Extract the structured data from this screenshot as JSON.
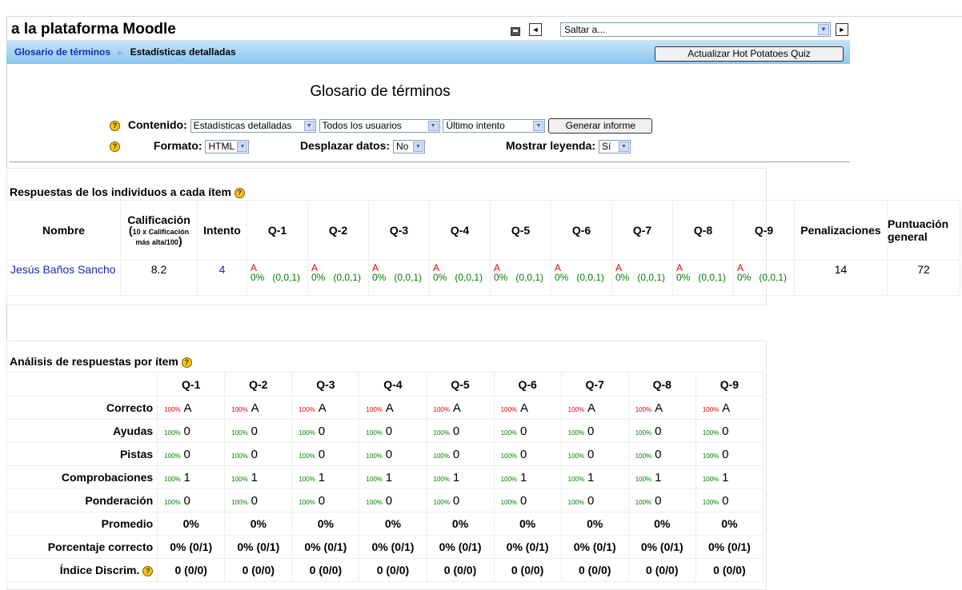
{
  "header": {
    "site_title": "a la plataforma Moodle",
    "jump_placeholder": "Saltar a...",
    "prev_arrow": "◄",
    "next_arrow": "►"
  },
  "breadcrumb": {
    "item1": "Glosario de términos",
    "item2": "Estadísticas detalladas",
    "separator": "►"
  },
  "update_button": "Actualizar Hot Potatoes Quiz",
  "page_title": "Glosario de términos",
  "form": {
    "contenido_label": "Contenido:",
    "contenido_value": "Estadísticas detalladas",
    "usuarios_value": "Todos los usuarios",
    "intento_value": "Último intento",
    "generate_button": "Generar informe",
    "formato_label": "Formato:",
    "formato_value": "HTML",
    "desplazar_label": "Desplazar datos:",
    "desplazar_value": "No",
    "leyenda_label": "Mostrar leyenda:",
    "leyenda_value": "Sí"
  },
  "responses_table": {
    "title": "Respuestas de los individuos a cada ítem",
    "col_nombre": "Nombre",
    "col_calificacion": "Calificación",
    "col_calif_sub1": "(",
    "col_calif_sub_small": "10 x Calificación más alta/100",
    "col_calif_sub2": ")",
    "col_intento": "Intento",
    "questions": [
      "Q-1",
      "Q-2",
      "Q-3",
      "Q-4",
      "Q-5",
      "Q-6",
      "Q-7",
      "Q-8",
      "Q-9"
    ],
    "col_penalizaciones": "Penalizaciones",
    "col_puntuacion": "Puntuación general",
    "row": {
      "name": "Jesús Baños Sancho",
      "grade": "8.2",
      "attempt": "4",
      "cells": [
        {
          "a": "A",
          "pct": "0%",
          "code": "(0,0,1)"
        },
        {
          "a": "A",
          "pct": "0%",
          "code": "(0,0,1)"
        },
        {
          "a": "A",
          "pct": "0%",
          "code": "(0,0,1)"
        },
        {
          "a": "A",
          "pct": "0%",
          "code": "(0,0,1)"
        },
        {
          "a": "A",
          "pct": "0%",
          "code": "(0,0,1)"
        },
        {
          "a": "A",
          "pct": "0%",
          "code": "(0,0,1)"
        },
        {
          "a": "A",
          "pct": "0%",
          "code": "(0,0,1)"
        },
        {
          "a": "A",
          "pct": "0%",
          "code": "(0,0,1)"
        },
        {
          "a": "A",
          "pct": "0%",
          "code": "(0,0,1)"
        }
      ],
      "penalties": "14",
      "overall": "72"
    }
  },
  "analysis_table": {
    "title": "Análisis de respuestas por ítem",
    "questions": [
      "Q-1",
      "Q-2",
      "Q-3",
      "Q-4",
      "Q-5",
      "Q-6",
      "Q-7",
      "Q-8",
      "Q-9"
    ],
    "rows": [
      {
        "label": "Correcto",
        "pct": "100%",
        "value": "A",
        "kind": "red"
      },
      {
        "label": "Ayudas",
        "pct": "100%",
        "value": "0",
        "kind": "green"
      },
      {
        "label": "Pistas",
        "pct": "100%",
        "value": "0",
        "kind": "green"
      },
      {
        "label": "Comprobaciones",
        "pct": "100%",
        "value": "1",
        "kind": "green"
      },
      {
        "label": "Ponderación",
        "pct": "100%",
        "value": "0",
        "kind": "green"
      }
    ],
    "summary_rows": [
      {
        "label": "Promedio",
        "values": [
          "0%",
          "0%",
          "0%",
          "0%",
          "0%",
          "0%",
          "0%",
          "0%",
          "0%"
        ]
      },
      {
        "label": "Porcentaje correcto",
        "values": [
          "0% (0/1)",
          "0% (0/1)",
          "0% (0/1)",
          "0% (0/1)",
          "0% (0/1)",
          "0% (0/1)",
          "0% (0/1)",
          "0% (0/1)",
          "0% (0/1)"
        ]
      },
      {
        "label": "Índice Discrim.",
        "values": [
          "0 (0/0)",
          "0 (0/0)",
          "0 (0/0)",
          "0 (0/0)",
          "0 (0/0)",
          "0 (0/0)",
          "0 (0/0)",
          "0 (0/0)",
          "0 (0/0)"
        ],
        "help": true
      }
    ]
  },
  "help_glyph": "?",
  "dropdown_glyph": "▼",
  "colors": {
    "link": "#1a28b8",
    "navbar_top": "#c6e4f8",
    "navbar_bottom": "#8cc6ee",
    "incorrect": "#e00000",
    "percent": "#008000"
  }
}
